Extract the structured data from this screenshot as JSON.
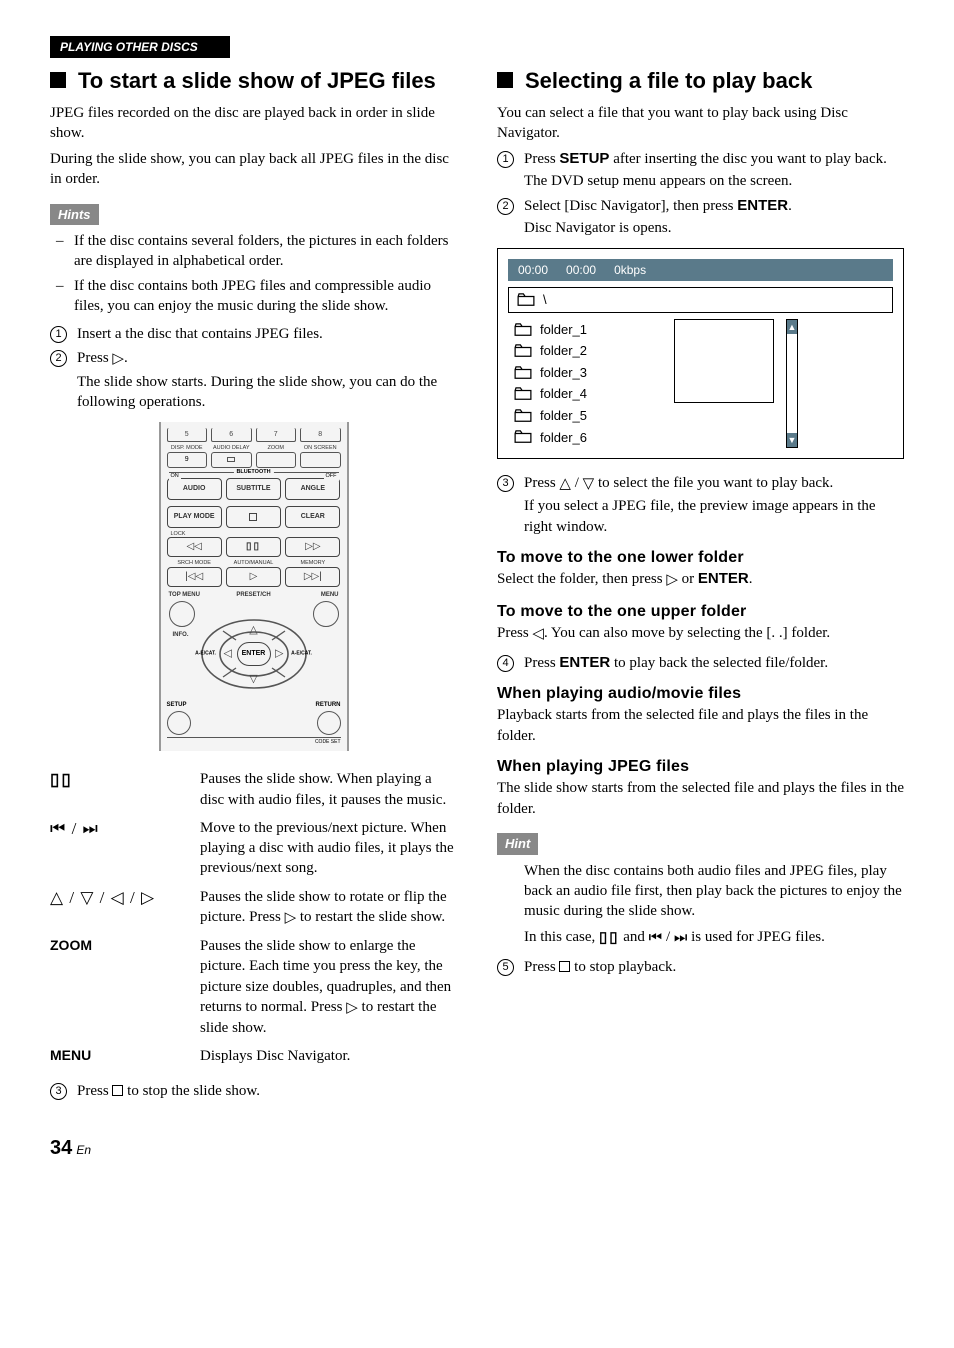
{
  "section_bar": "PLAYING OTHER DISCS",
  "left": {
    "heading": "To start a slide show of JPEG files",
    "intro1": "JPEG files recorded on the disc are played back in order in slide show.",
    "intro2": "During the slide show, you can play back all JPEG files in the disc in order.",
    "hints_label": "Hints",
    "hint1": "If the disc contains several folders, the pictures in each folders are displayed in alphabetical order.",
    "hint2": "If the disc contains both JPEG files and compressible audio files, you can enjoy the music during the slide show.",
    "step1": "Insert a the disc that contains JPEG files.",
    "step2a": "Press ",
    "step2b": ".",
    "step2_sub": "The slide show starts. During the slide show, you can do the following operations.",
    "ops": {
      "pause": "Pauses the slide show. When playing a disc with audio files, it pauses the music.",
      "skip": "Move to the previous/next picture. When playing a disc with audio files, it plays the previous/next song.",
      "arrows_a": "Pauses the slide show to rotate or flip the picture. Press ",
      "arrows_b": " to restart the slide show.",
      "zoom_label": "ZOOM",
      "zoom_a": "Pauses the slide show to enlarge the picture. Each time you press the key, the picture size doubles, quadruples, and then returns to normal. Press ",
      "zoom_b": " to restart the slide show.",
      "menu_label": "MENU",
      "menu": "Displays Disc Navigator."
    },
    "step3a": "Press ",
    "step3b": " to stop the slide show."
  },
  "remote": {
    "nums": [
      "5",
      "6",
      "7",
      "8"
    ],
    "labels1": [
      "DISP. MODE",
      "AUDIO DELAY",
      "ZOOM",
      "ON SCREEN"
    ],
    "bt_on": "ON",
    "bt": "BLUETOOTH",
    "bt_off": "OFF",
    "row1": [
      "AUDIO",
      "SUBTITLE",
      "ANGLE"
    ],
    "row2": [
      "PLAY MODE",
      "",
      "CLEAR"
    ],
    "lock": "LOCK",
    "labels3": [
      "SRCH MODE",
      "AUTO/MANUAL",
      "MEMORY"
    ],
    "top_menu": "TOP MENU",
    "preset": "PRESET/CH",
    "menu": "MENU",
    "info": "INFO.",
    "enter": "ENTER",
    "aecat": "A-E/CAT.",
    "setup": "SETUP",
    "ret": "RETURN",
    "codeset": "CODE SET"
  },
  "right": {
    "heading": "Selecting a file to play back",
    "intro": "You can select a file that you want to play back using Disc Navigator.",
    "step1a": "Press ",
    "step1_setup": "SETUP",
    "step1b": " after inserting the disc you want to play back.",
    "step1_sub": "The DVD setup menu appears on the screen.",
    "step2a": "Select [Disc Navigator], then press ",
    "step2_enter": "ENTER",
    "step2b": ".",
    "step2_sub": "Disc Navigator is opens.",
    "nav": {
      "t1": "00:00",
      "t2": "00:00",
      "kbps": "0kbps",
      "root": "\\",
      "folders": [
        "folder_1",
        "folder_2",
        "folder_3",
        "folder_4",
        "folder_5",
        "folder_6"
      ]
    },
    "step3a": "Press ",
    "step3b": " to select the file you want to play back.",
    "step3_sub": "If you select a JPEG file, the preview image appears in the right window.",
    "lower_h": "To move to the one lower folder",
    "lower_a": "Select the folder, then press ",
    "lower_b": " or ",
    "lower_enter": "ENTER",
    "lower_c": ".",
    "upper_h": "To move to the one upper folder",
    "upper_a": "Press ",
    "upper_b": ". You can also move by selecting the [. .] folder.",
    "step4a": "Press ",
    "step4_enter": "ENTER",
    "step4b": " to play back the selected file/folder.",
    "audio_h": "When playing audio/movie files",
    "audio_p": "Playback starts from the selected file and plays the files in the folder.",
    "jpeg_h": "When playing JPEG files",
    "jpeg_p": "The slide show starts from the selected file and plays the files in the folder.",
    "hint_label": "Hint",
    "hint_p1": "When the disc contains both audio files and JPEG files, play back an audio file first, then play back the pictures to enjoy the music during the slide show.",
    "hint_p2a": "In this case, ",
    "hint_p2b": " and ",
    "hint_p2c": " is used for JPEG files.",
    "step5a": "Press ",
    "step5b": " to stop playback."
  },
  "page": {
    "num": "34",
    "lang": "En"
  }
}
